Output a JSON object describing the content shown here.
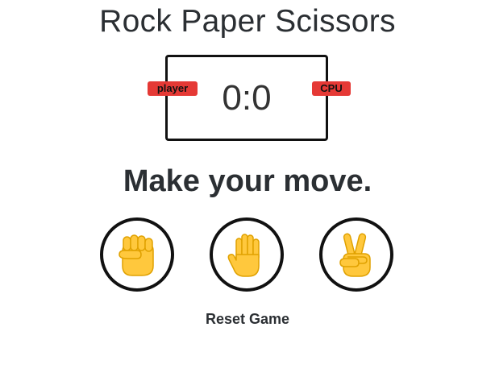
{
  "game": {
    "title": "Rock Paper Scissors",
    "score_display": "0:0",
    "player_label": "player",
    "cpu_label": "CPU",
    "prompt": "Make your move.",
    "reset_label": "Reset Game"
  },
  "choices": [
    {
      "name": "rock",
      "icon": "raised-fist-icon"
    },
    {
      "name": "paper",
      "icon": "raised-hand-icon"
    },
    {
      "name": "scissors",
      "icon": "victory-hand-icon"
    }
  ],
  "colors": {
    "badge": "#e53935",
    "border": "#111111",
    "text": "#2b2f33",
    "emoji_skin": "#ffc83d",
    "emoji_outline": "#e0a100"
  }
}
